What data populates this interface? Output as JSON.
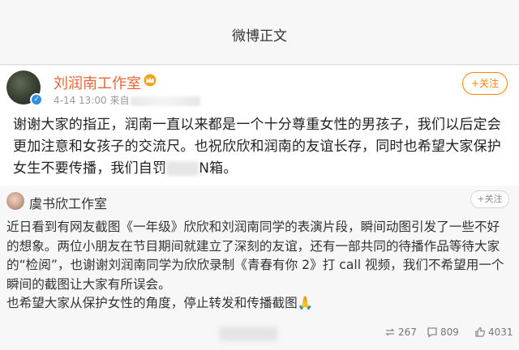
{
  "header": {
    "title": "微博正文"
  },
  "post": {
    "author": "刘润南工作室",
    "time": "4-14 13:00",
    "source_prefix": "来自",
    "follow_label": "+关注",
    "text_part1": "谢谢大家的指正，润南一直以来都是一个十分尊重女性的男孩子，我们以后定会更加注意和女孩子的交流尺。也祝欣欣和润南的友谊长存，同时也希望大家保护女生不要传播，我们自罚",
    "text_part2": "N箱。"
  },
  "quote": {
    "author": "虞书欣工作室",
    "follow_label": "+关注",
    "text": "近日看到有网友截图《一年级》欣欣和刘润南同学的表演片段，瞬间动图引发了一些不好的想象。两位小朋友在节目期间就建立了深刻的友谊，还有一部共同的待播作品等待大家的“检阅”，也谢谢刘润南同学为欣欣录制《青春有你 2》打 call 视频，我们不希望用一个瞬间的截图让大家有所误会。",
    "text2": "也希望大家从保护女性的角度，停止转发和传播截图🙏",
    "reposts": "267",
    "comments": "809",
    "likes": "4031"
  },
  "colors": {
    "accent": "#ff8200",
    "author": "#e8663b",
    "verified": "#2e8fe0"
  }
}
